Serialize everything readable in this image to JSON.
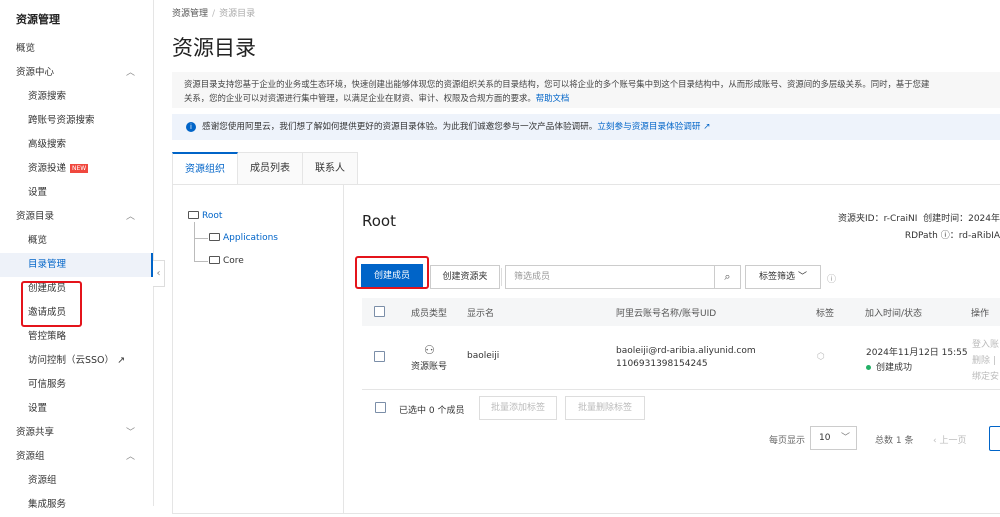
{
  "sidebar": {
    "title": "资源管理",
    "items": [
      {
        "label": "概览"
      },
      {
        "label": "资源中心"
      },
      {
        "label": "资源搜索"
      },
      {
        "label": "跨账号资源搜索"
      },
      {
        "label": "高级搜索"
      },
      {
        "label": "资源投递",
        "badge": "NEW"
      },
      {
        "label": "设置"
      },
      {
        "label": "资源目录"
      },
      {
        "label": "概览"
      },
      {
        "label": "目录管理"
      },
      {
        "label": "创建成员"
      },
      {
        "label": "邀请成员"
      },
      {
        "label": "管控策略"
      },
      {
        "label": "访问控制（云SSO）"
      },
      {
        "label": "可信服务"
      },
      {
        "label": "设置"
      },
      {
        "label": "资源共享"
      },
      {
        "label": "资源组"
      },
      {
        "label": "资源组"
      },
      {
        "label": "集成服务"
      }
    ]
  },
  "breadcrumb": [
    "资源管理",
    "资源目录"
  ],
  "page_title": "资源目录",
  "description": {
    "line1": "资源目录支持您基于企业的业务或生态环境，快速创建出能够体现您的资源组织关系的目录结构，您可以将企业的多个账号集中到这个目录结构中，从而形成账号、资源间的多层级关系。同时，基于您建",
    "line2": "关系，您的企业可以对资源进行集中管理，以满足企业在财资、审计、权限及合规方面的要求。",
    "help_link": "帮助文档"
  },
  "notice": {
    "text": "感谢您使用阿里云，我们想了解如何提供更好的资源目录体验。为此我们诚邀您参与一次产品体验调研。",
    "link": "立刻参与资源目录体验调研"
  },
  "tabs": [
    "资源组织",
    "成员列表",
    "联系人"
  ],
  "tree": {
    "root": "Root",
    "children": [
      "Applications",
      "Core"
    ]
  },
  "folder": {
    "title": "Root",
    "id_label": "资源夹ID：r-CraiNI",
    "created_label": "创建时间：2024年",
    "rdpath_label": "RDPath",
    "rdpath_value": "：rd-aRibIA"
  },
  "toolbar": {
    "create_member": "创建成员",
    "create_folder": "创建资源夹",
    "search_placeholder": "筛选成员",
    "tag_filter": "标签筛选"
  },
  "table": {
    "headers": [
      "成员类型",
      "显示名",
      "阿里云账号名称/账号UID",
      "标签",
      "加入时间/状态",
      "操作"
    ],
    "rows": [
      {
        "type": "资源账号",
        "name": "baoleiji",
        "account": "baoleiji@rd-aribia.aliyunid.com",
        "uid": "1106931398154245",
        "time": "2024年11月12日 15:55",
        "status": "创建成功",
        "ops": [
          "登入账",
          "删除 |",
          "绑定安"
        ]
      }
    ]
  },
  "footer": {
    "selected": "已选中 0 个成员",
    "batch_add": "批量添加标签",
    "batch_remove": "批量删除标签"
  },
  "pagination": {
    "per_page_label": "每页显示",
    "per_page": "10",
    "total": "总数 1 条",
    "prev": "上一页"
  },
  "colors": {
    "accent": "#0064c8",
    "highlight": "#e4141b",
    "success": "#23b066"
  }
}
